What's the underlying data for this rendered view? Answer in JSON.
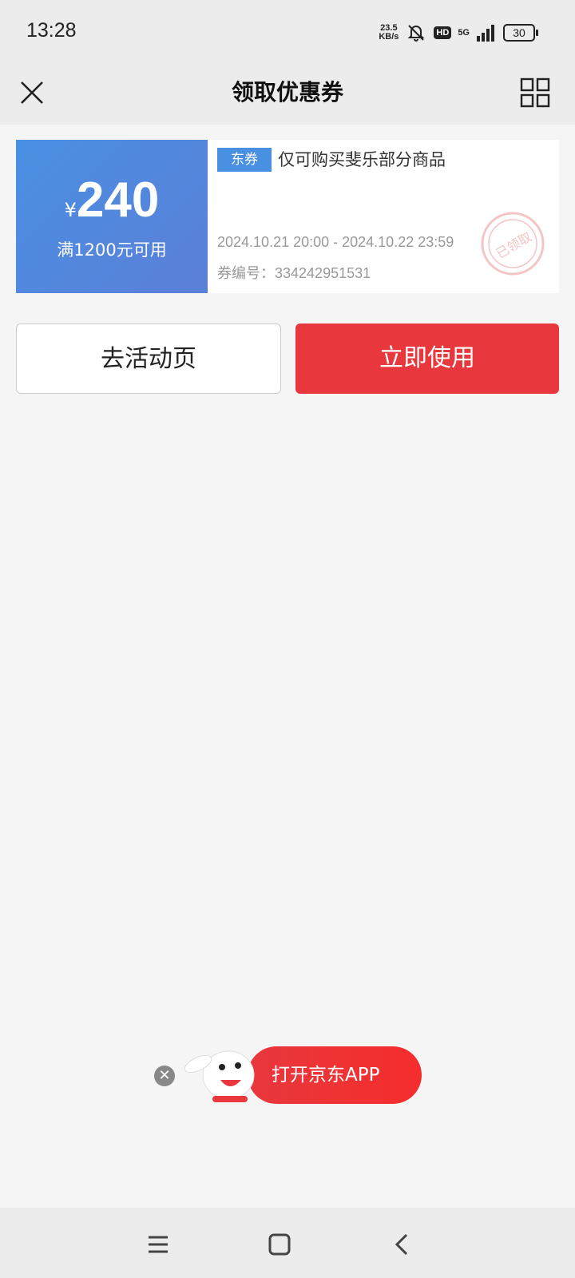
{
  "status_bar": {
    "time": "13:28",
    "speed_value": "23.5",
    "speed_unit": "KB/s",
    "hd": "HD",
    "network": "5G",
    "battery": "30",
    "icons": [
      "mute-icon",
      "signal-icon",
      "battery-icon"
    ]
  },
  "header": {
    "title": "领取优惠券",
    "left_icon": "close-icon",
    "right_icon": "grid-icon"
  },
  "coupon": {
    "currency": "¥",
    "amount": "240",
    "condition": "满1200元可用",
    "tag": "东券",
    "description": "仅可购买斐乐部分商品",
    "validity": "2024.10.21 20:00 - 2024.10.22 23:59",
    "code_label": "券编号：",
    "code": "334242951531",
    "stamp_text": "已领取",
    "colors": {
      "left_bg": "#4a90e2",
      "stamp": "#f3c6c6"
    }
  },
  "actions": {
    "activity_label": "去活动页",
    "use_label": "立即使用",
    "use_color": "#e8383d"
  },
  "float_banner": {
    "label": "打开京东APP",
    "close_icon": "close-icon",
    "mascot_icon": "joy-dog-mascot"
  },
  "navbar": {
    "icons": [
      "menu-icon",
      "home-icon",
      "back-icon"
    ]
  }
}
